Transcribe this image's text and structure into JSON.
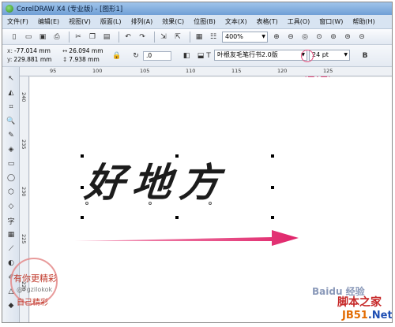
{
  "window": {
    "title": "CorelDRAW X4 (专业版) - [图形1]"
  },
  "menu": [
    "文件(F)",
    "编辑(E)",
    "视图(V)",
    "版面(L)",
    "排列(A)",
    "效果(C)",
    "位图(B)",
    "文本(X)",
    "表格(T)",
    "工具(O)",
    "窗口(W)",
    "帮助(H)"
  ],
  "toolbar": {
    "zoom": "400%",
    "icons": [
      "new-icon",
      "open-icon",
      "save-icon",
      "print-icon",
      "cut-icon",
      "copy-icon",
      "paste-icon",
      "undo-icon",
      "redo-icon",
      "import-icon",
      "export-icon",
      "app-launcher-icon",
      "zoom-in-icon",
      "zoom-out-icon",
      "zoom-selected-icon",
      "zoom-all-icon",
      "zoom-page-icon",
      "zoom-width-icon",
      "zoom-height-icon"
    ]
  },
  "propbar": {
    "x": "-77.014 mm",
    "y": "229.881 mm",
    "width": "26.094 mm",
    "height": "7.938 mm",
    "rotation": ".0",
    "font": "叶根友毛笔行书2.0版",
    "font_size": "24 pt"
  },
  "ruler": {
    "h_labels": [
      "95",
      "100",
      "105",
      "110",
      "115",
      "120",
      "125"
    ],
    "v_labels": [
      "240",
      "235",
      "230",
      "225",
      "220"
    ]
  },
  "canvas": {
    "text": "好地方",
    "arrow_color": "#e0246a"
  },
  "highlight": {
    "color": "#e84a7a",
    "icon": "heart-icon"
  },
  "watermarks": {
    "left_line1": "有你更精彩",
    "left_line2": "@Fgzilokok",
    "left_line3": "自己精彩",
    "baidu": "Baidu 经验",
    "site": "脚本之家",
    "domain_a": "JB51",
    "domain_b": ".Net"
  }
}
